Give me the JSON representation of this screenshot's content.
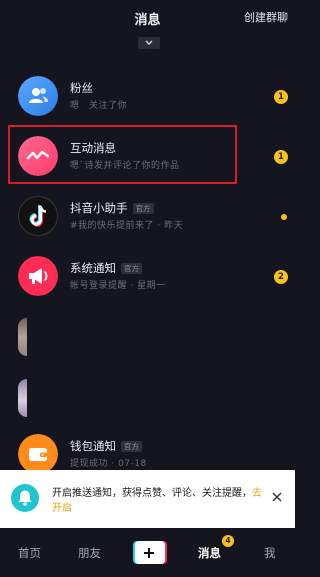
{
  "header": {
    "title": "消息",
    "create_group": "创建群聊"
  },
  "messages": [
    {
      "name": "粉丝",
      "tag": "",
      "subtitle": "嗯　关注了你",
      "badge": "1"
    },
    {
      "name": "互动消息",
      "tag": "",
      "subtitle": "嗯`诗发并评论了你的作品",
      "badge": "1"
    },
    {
      "name": "抖音小助手",
      "tag": "官方",
      "subtitle": "#我的快乐提前来了 · 昨天",
      "badge": ""
    },
    {
      "name": "系统通知",
      "tag": "官方",
      "subtitle": "帐号登录提醒 · 星期一",
      "badge": "2"
    },
    {
      "name": "钱包通知",
      "tag": "官方",
      "subtitle": "提现成功 · 07-18",
      "badge": ""
    }
  ],
  "banner": {
    "text": "开启推送通知，获得点赞、评论、关注提醒，",
    "link": "去开启"
  },
  "nav": {
    "home": "首页",
    "friends": "朋友",
    "messages": "消息",
    "messages_badge": "4",
    "me": "我"
  },
  "colors": {
    "background": "#14151e",
    "badge": "#f7c21a",
    "highlight": "#d81e2a",
    "fans_avatar": "#3d8ff0",
    "interaction_avatar": "#ff4f7a",
    "system_avatar": "#ff2d55",
    "wallet_avatar": "#ff8c1a",
    "banner_bell": "#1ec4cf"
  },
  "icons": {
    "fans": "people-icon",
    "interaction": "wave-icon",
    "assistant": "tiktok-note-icon",
    "system": "megaphone-icon",
    "wallet": "wallet-icon",
    "banner": "bell-icon"
  }
}
